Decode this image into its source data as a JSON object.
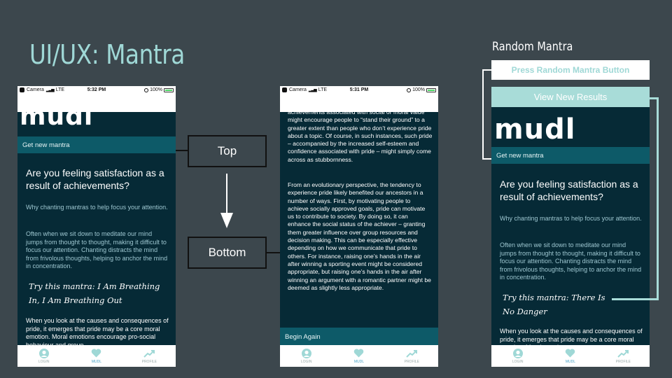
{
  "slide": {
    "title": "UI/UX: Mantra",
    "random_title": "Random Mantra"
  },
  "status": {
    "carrier": "Camera",
    "network": "LTE",
    "battery": "100%",
    "time1": "5:32 PM",
    "time2": "5:31 PM",
    "time3": ""
  },
  "app": {
    "logo": "mudl",
    "get_new": "Get new mantra",
    "question": "Are you feeling satisfaction as a result of achievements?",
    "why": "Why chanting mantras to help focus your attention.",
    "often": "Often when we sit down to meditate our mind jumps from thought to thought, making it difficult to focus our attention. Chanting distracts the mind from frivolous thoughts, helping to anchor the mind in concentration.",
    "mantra1": "Try this mantra: I Am Breathing In, I Am Breathing Out",
    "mantra3": "Try this mantra: There Is No Danger",
    "causes": "When you look at the causes and consequences of pride, it emerges that pride may be a core moral emotion. Moral emotions encourage pro-social behaviour and group",
    "causes3": "When you look at the causes and consequences of pride, it emerges that pride may be a core moral emotion. Moral emotions",
    "long_p1": "achievements associated with social or moral value might encourage people to “stand their ground” to a greater extent than people who don’t experience pride about a topic. Of course, in such instances, such pride – accompanied by the increased self-esteem and confidence associated with pride – might simply come across as stubbornness.",
    "long_p2": "From an evolutionary perspective, the tendency to experience pride likely benefited our ancestors in a number of ways. First, by motivating people to achieve socially approved goals, pride can motivate us to contribute to society. By doing so, it can enhance the social status of the achiever – granting them greater influence over group resources and decision making. This can be especially effective depending on how we communicate that pride to others. For instance, raising one’s hands in the air after winning a sporting event might be considered appropriate, but raising one’s hands in the air after winning an argument with a romantic partner might be deemed as slightly less appropriate.",
    "begin_again": "Begin Again",
    "tabs": [
      "LOGIN",
      "MUDL",
      "PROFILE"
    ]
  },
  "labels": {
    "top": "Top",
    "bottom": "Bottom"
  },
  "random": {
    "press": "Press Random Mantra Button",
    "view": "View New Results"
  },
  "colors": {
    "accent": "#9fd8d6",
    "app_bg": "#062a36",
    "bar": "#0d5a68"
  }
}
